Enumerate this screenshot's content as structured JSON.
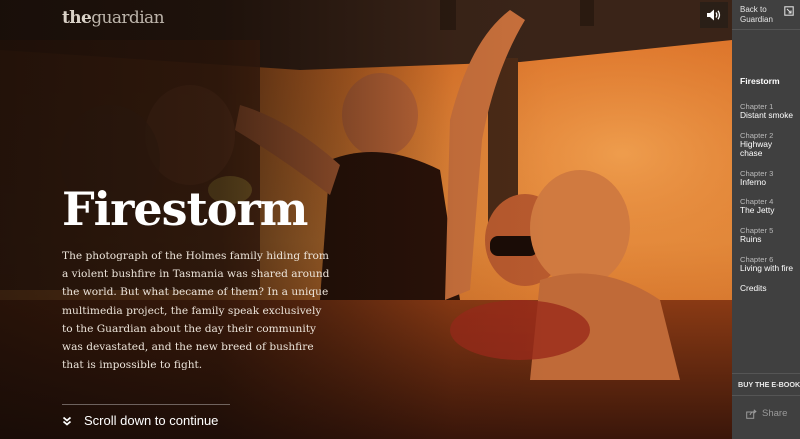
{
  "logo": {
    "bold": "the",
    "light": "guardian",
    "full": "theguardian"
  },
  "audio": {
    "icon": "speaker-volume-icon"
  },
  "hero": {
    "title": "Firestorm",
    "intro": "The photograph of the Holmes family hiding from a violent bushfire in Tasmania was shared around the world. But what became of them? In a unique multimedia project, the family speak exclusively to the Guardian about the day their community was devastated, and the new breed of bushfire that is impossible to fight.",
    "scroll_label": "Scroll down to continue",
    "scroll_icon": "double-chevron-down-icon"
  },
  "sidebar": {
    "back_line1": "Back to",
    "back_line2": "Guardian",
    "back_icon": "external-link-icon",
    "main_item": "Firestorm",
    "chapters": [
      {
        "num": "Chapter 1",
        "title": "Distant smoke"
      },
      {
        "num": "Chapter 2",
        "title": "Highway chase"
      },
      {
        "num": "Chapter 3",
        "title": "Inferno"
      },
      {
        "num": "Chapter 4",
        "title": "The Jetty"
      },
      {
        "num": "Chapter 5",
        "title": "Ruins"
      },
      {
        "num": "Chapter 6",
        "title": "Living with fire"
      }
    ],
    "credits": "Credits",
    "buy_ebook": "BUY THE E-BOOK",
    "share": "Share",
    "share_icon": "share-icon"
  },
  "colors": {
    "sidebar_bg": "#404040",
    "photo_orange": "#c2581c",
    "title_text": "#ffffff"
  }
}
